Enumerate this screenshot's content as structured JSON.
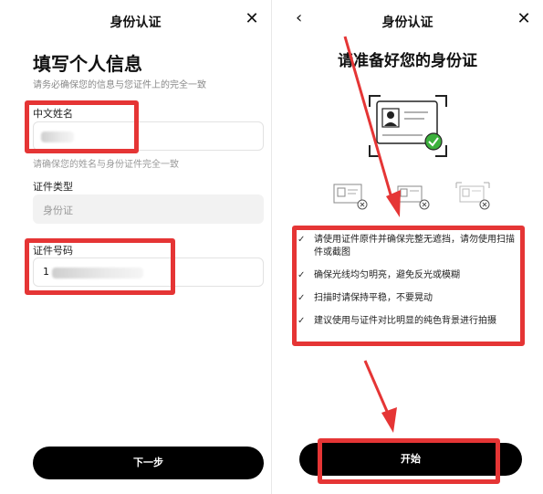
{
  "left": {
    "title": "身份认证",
    "close_icon": "close-icon",
    "heading": "填写个人信息",
    "subheading": "请务必确保您的信息与您证件上的完全一致",
    "name_label": "中文姓名",
    "name_hint": "请确保您的姓名与身份证件完全一致",
    "id_type_label": "证件类型",
    "id_type_value": "身份证",
    "id_number_label": "证件号码",
    "id_number_prefix": "1",
    "next_button": "下一步"
  },
  "right": {
    "title": "身份认证",
    "back_icon": "chevron-left-icon",
    "close_icon": "close-icon",
    "heading": "请准备好您的身份证",
    "tips": [
      "请使用证件原件并确保完整无遮挡，请勿使用扫描件或截图",
      "确保光线均匀明亮，避免反光或模糊",
      "扫描时请保持平稳，不要晃动",
      "建议使用与证件对比明显的纯色背景进行拍摄"
    ],
    "start_button": "开始"
  },
  "colors": {
    "annotation": "#e53535",
    "button": "#000000",
    "check_badge": "#3cb03c"
  }
}
